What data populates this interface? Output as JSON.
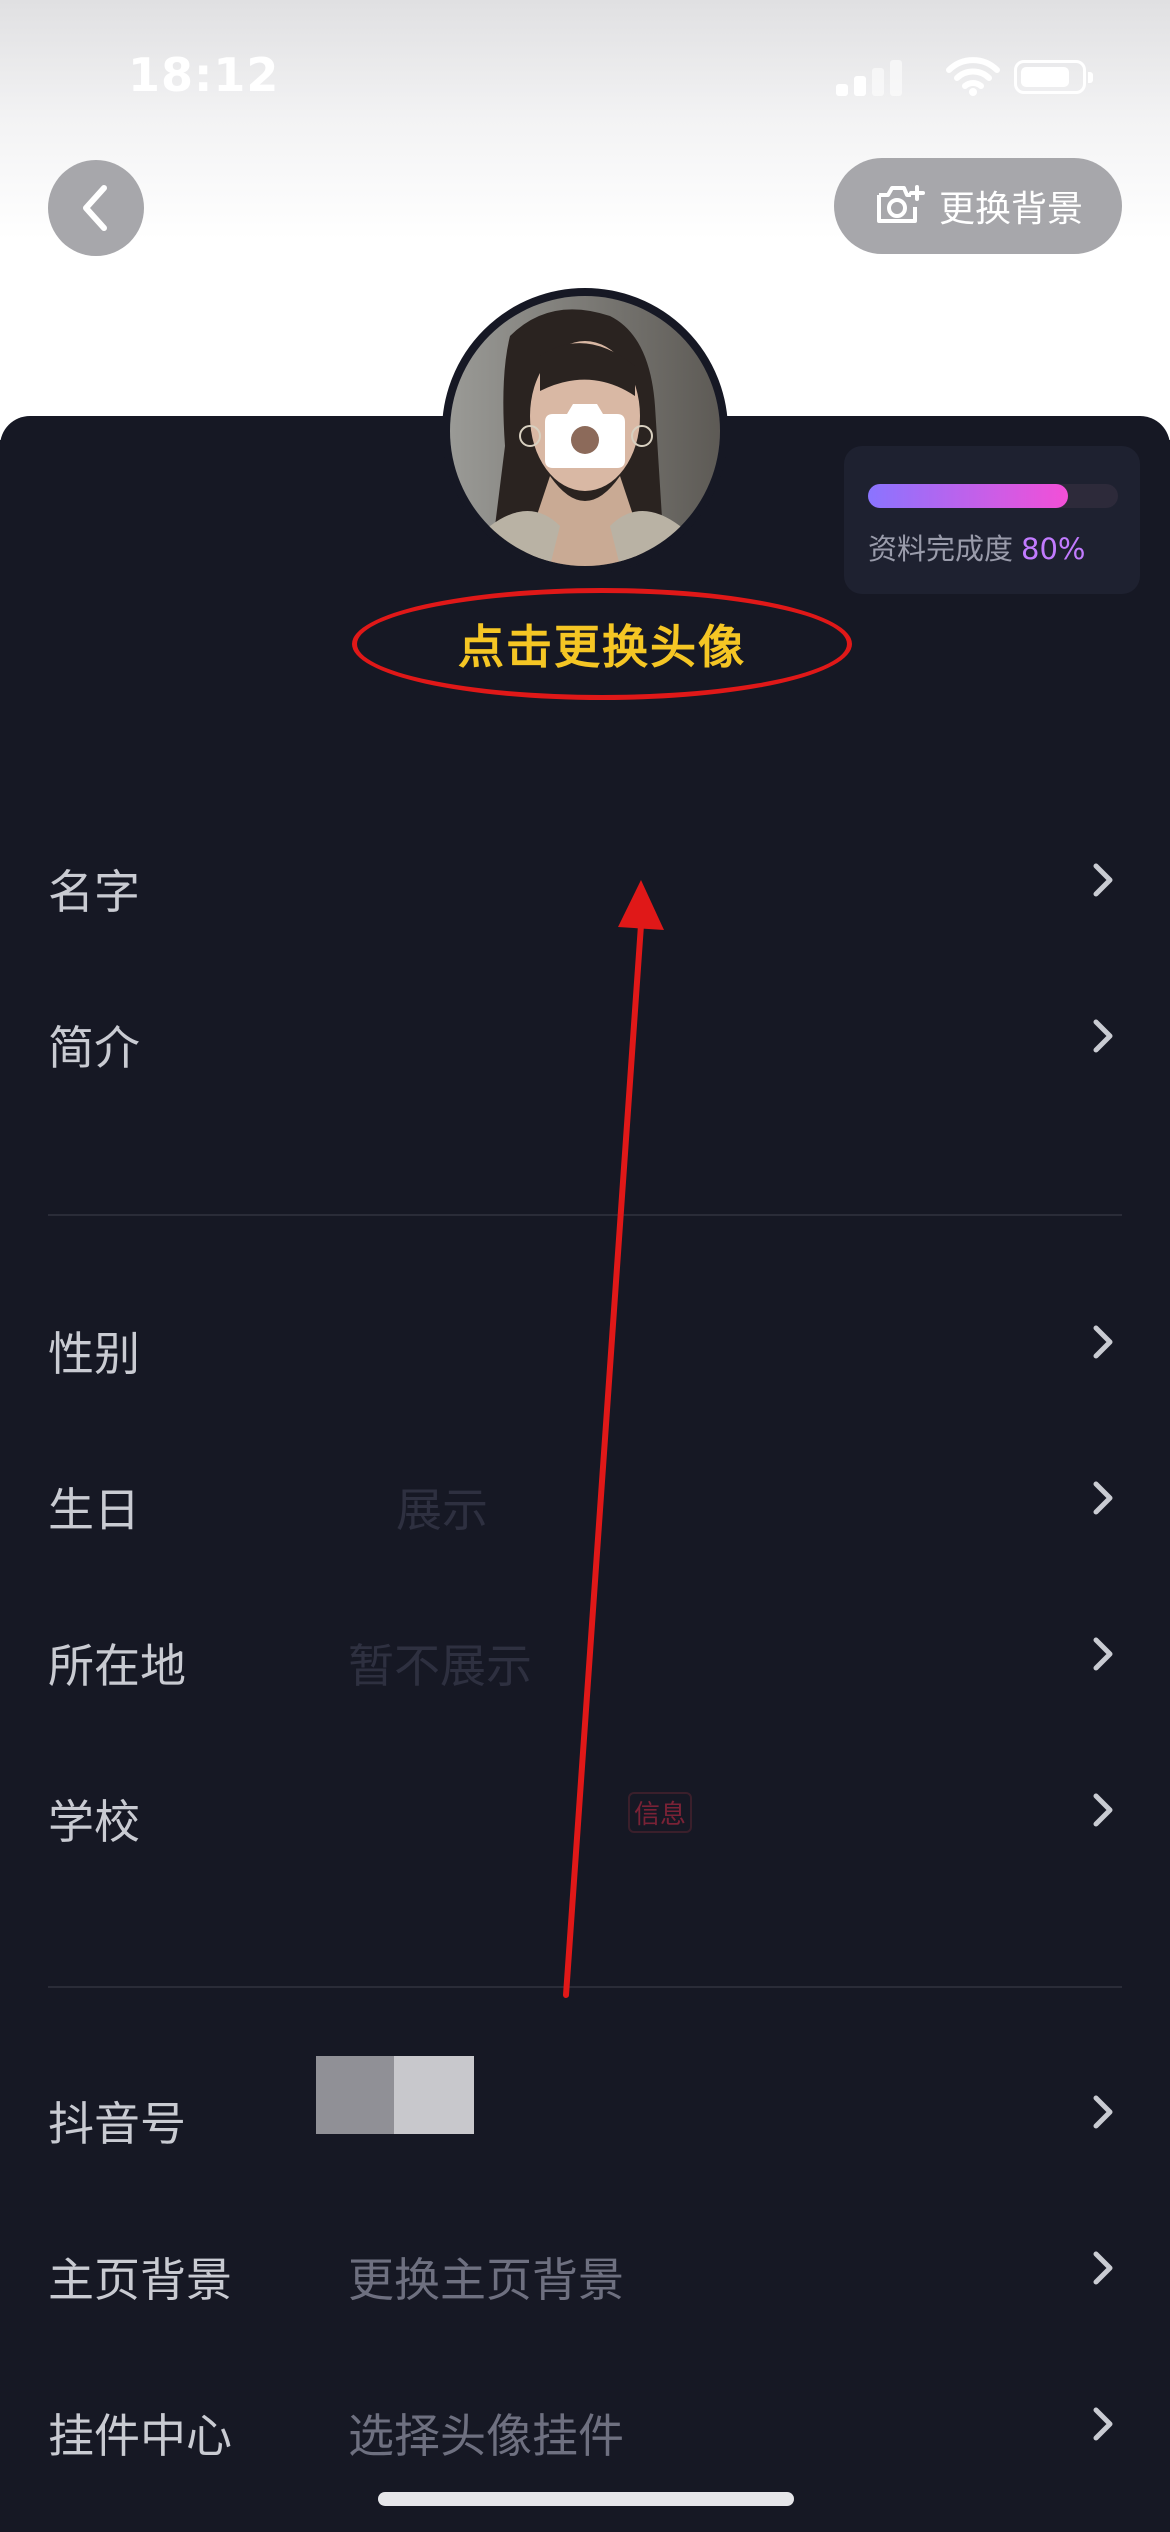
{
  "status_bar": {
    "time": "18:12"
  },
  "header": {
    "change_background_label": "更换背景"
  },
  "completion": {
    "label": "资料完成度",
    "percent_text": "80%",
    "percent_value": 80
  },
  "avatar": {
    "change_label": "点击更换头像"
  },
  "profile_rows_group1": [
    {
      "label": "名字",
      "value": ""
    },
    {
      "label": "简介",
      "value": ""
    }
  ],
  "profile_rows_group2": [
    {
      "label": "性别",
      "value": ""
    },
    {
      "label": "生日",
      "value": "展示"
    },
    {
      "label": "所在地",
      "value": "暂不展示"
    },
    {
      "label": "学校",
      "value": "",
      "tag": "信息"
    }
  ],
  "profile_rows_group3": [
    {
      "label": "抖音号",
      "value": ""
    },
    {
      "label": "主页背景",
      "value": "更换主页背景"
    },
    {
      "label": "挂件中心",
      "value": "选择头像挂件"
    }
  ],
  "colors": {
    "card_bg": "#161824",
    "annotation_red": "#e01818",
    "annotation_text": "#f5c624",
    "accent_purple": "#c27bff"
  }
}
